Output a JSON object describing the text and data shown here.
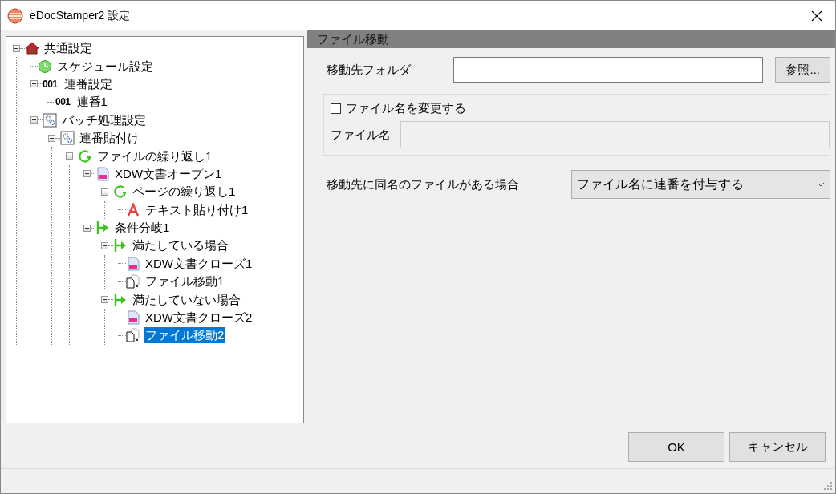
{
  "window": {
    "title": "eDocStamper2 設定"
  },
  "tree": [
    {
      "label": "共通設定",
      "kind": "home",
      "expanded": true,
      "selected": false,
      "children": [
        {
          "label": "スケジュール設定",
          "kind": "clock",
          "selected": false
        },
        {
          "label": "連番設定",
          "kind": "number",
          "badge": "001",
          "expanded": true,
          "selected": false,
          "children": [
            {
              "label": "連番1",
              "kind": "number",
              "badge": "001",
              "selected": false
            }
          ]
        },
        {
          "label": "バッチ処理設定",
          "kind": "gear",
          "expanded": true,
          "selected": false,
          "children": [
            {
              "label": "連番貼付け",
              "kind": "gear",
              "expanded": true,
              "selected": false,
              "children": [
                {
                  "label": "ファイルの繰り返し1",
                  "kind": "loop",
                  "expanded": true,
                  "selected": false,
                  "children": [
                    {
                      "label": "XDW文書オープン1",
                      "kind": "doc",
                      "expanded": true,
                      "selected": false,
                      "children": [
                        {
                          "label": "ページの繰り返し1",
                          "kind": "loop",
                          "expanded": true,
                          "selected": false,
                          "children": [
                            {
                              "label": "テキスト貼り付け1",
                              "kind": "text",
                              "selected": false
                            }
                          ]
                        }
                      ]
                    },
                    {
                      "label": "条件分岐1",
                      "kind": "branch",
                      "expanded": true,
                      "selected": false,
                      "children": [
                        {
                          "label": "満たしている場合",
                          "kind": "branch",
                          "expanded": true,
                          "selected": false,
                          "children": [
                            {
                              "label": "XDW文書クローズ1",
                              "kind": "doc",
                              "selected": false
                            },
                            {
                              "label": "ファイル移動1",
                              "kind": "move",
                              "selected": false
                            }
                          ]
                        },
                        {
                          "label": "満たしていない場合",
                          "kind": "branch",
                          "expanded": true,
                          "selected": false,
                          "children": [
                            {
                              "label": "XDW文書クローズ2",
                              "kind": "doc",
                              "selected": false
                            },
                            {
                              "label": "ファイル移動2",
                              "kind": "move",
                              "selected": true
                            }
                          ]
                        }
                      ]
                    }
                  ]
                }
              ]
            }
          ]
        }
      ]
    }
  ],
  "panel": {
    "title": "ファイル移動",
    "folder": {
      "label": "移動先フォルダ",
      "button": "参照..."
    },
    "rename": {
      "label": "ファイル名を変更する",
      "checked": false,
      "field_label": "ファイル名",
      "field_disabled": true
    },
    "conflict": {
      "label": "移動先に同名のファイルがある場合",
      "value": "ファイル名に連番を付与する"
    }
  },
  "buttons": [
    "OK",
    "キャンセル"
  ]
}
